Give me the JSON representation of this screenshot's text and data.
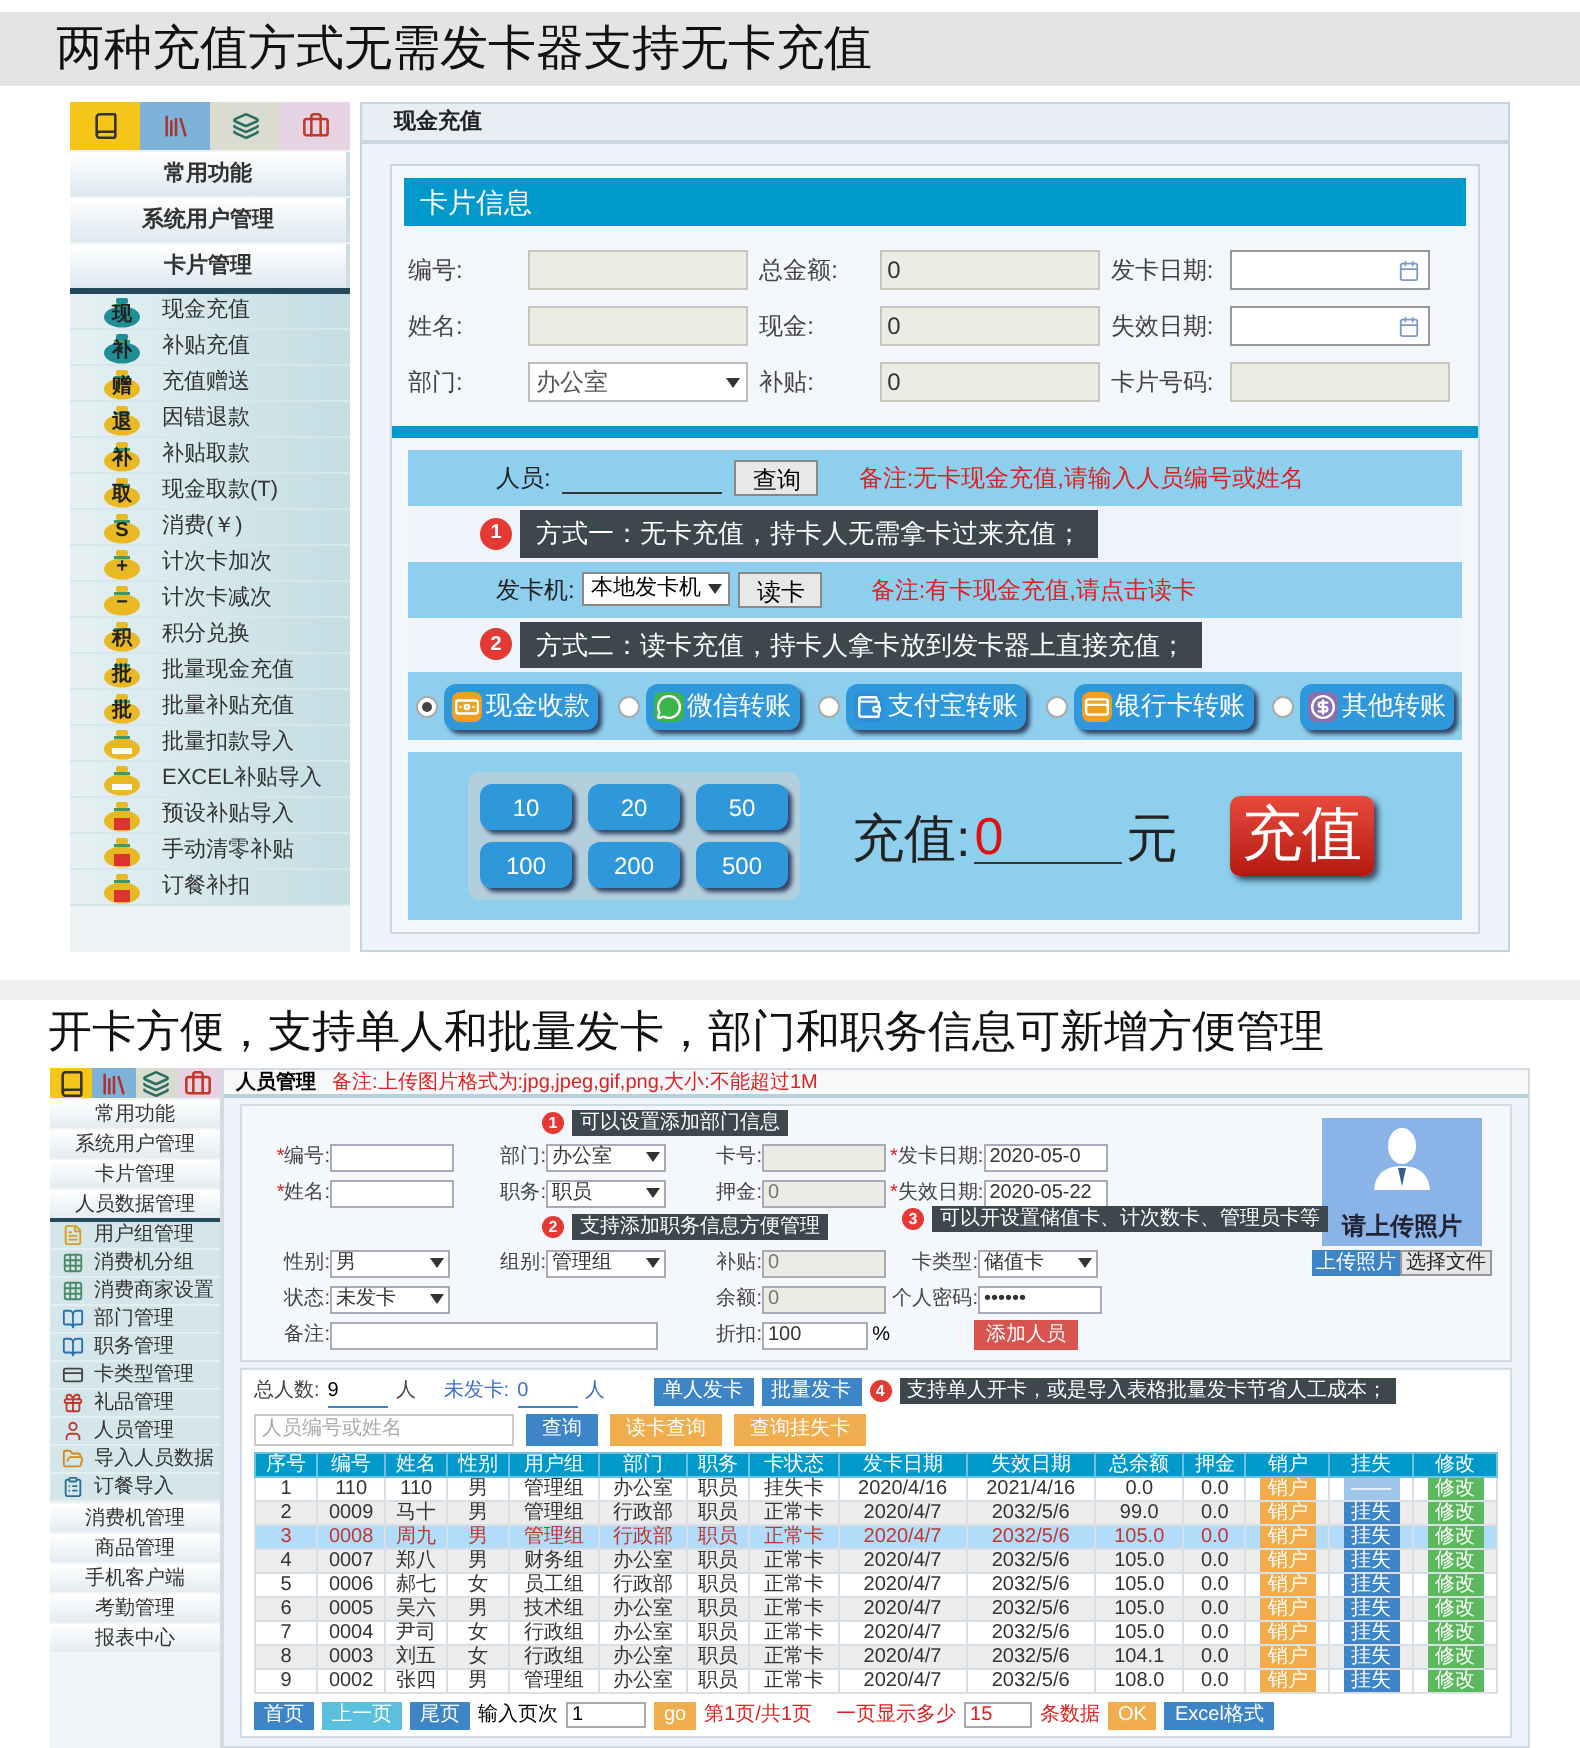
{
  "section_1": {
    "heading": "两种充值方式无需发卡器支持无卡充值",
    "sidebar": {
      "tabs": [
        {
          "kind": "book",
          "color": "#f5c518"
        },
        {
          "kind": "books",
          "color": "#7fb2d9"
        },
        {
          "kind": "layers",
          "color": "#d9dccf"
        },
        {
          "kind": "briefcase",
          "color": "#e6d3e3"
        }
      ],
      "groups": [
        {
          "label": "常用功能"
        },
        {
          "label": "系统用户管理"
        },
        {
          "label": "卡片管理",
          "children": [
            {
              "label": "现金充值",
              "kind": "glyph",
              "badge": "现",
              "color": "#1f8f95"
            },
            {
              "label": "补贴充值",
              "kind": "glyph",
              "badge": "补",
              "color": "#1f8f95"
            },
            {
              "label": "充值赠送",
              "kind": "glyph",
              "badge": "赠",
              "color": "#e8b923"
            },
            {
              "label": "因错退款",
              "kind": "glyph",
              "badge": "退",
              "color": "#e8b923"
            },
            {
              "label": "补贴取款",
              "kind": "glyph",
              "badge": "补",
              "color": "#e8b923"
            },
            {
              "label": "现金取款(T)",
              "kind": "glyph",
              "badge": "取",
              "color": "#e8b923"
            },
            {
              "label": "消费(￥)",
              "kind": "glyph",
              "badge": "S",
              "color": "#e8b923"
            },
            {
              "label": "计次卡加次",
              "kind": "glyph",
              "badge": "+",
              "color": "#e8b923"
            },
            {
              "label": "计次卡减次",
              "kind": "glyph",
              "badge": "−",
              "color": "#e8b923"
            },
            {
              "label": "积分兑换",
              "kind": "glyph",
              "badge": "积",
              "color": "#e8b923"
            },
            {
              "label": "批量现金充值",
              "kind": "glyph",
              "badge": "批",
              "color": "#e8b923"
            },
            {
              "label": "批量补贴充值",
              "kind": "glyph",
              "badge": "批",
              "color": "#e8b923"
            },
            {
              "label": "批量扣款导入",
              "kind": "bar",
              "color": "#e8b923"
            },
            {
              "label": "EXCEL补贴导入",
              "kind": "bar",
              "color": "#e8b923"
            },
            {
              "label": "预设补贴导入",
              "kind": "box",
              "color": "#e8b923"
            },
            {
              "label": "手动清零补贴",
              "kind": "box",
              "color": "#e8b923"
            },
            {
              "label": "订餐补扣",
              "kind": "box",
              "color": "#e8b923"
            }
          ]
        }
      ]
    },
    "page_tab": "现金充值",
    "card_title": "卡片信息",
    "fields": [
      {
        "label": "编号:",
        "kind": "text"
      },
      {
        "label": "总金额:",
        "kind": "text",
        "value": "0"
      },
      {
        "label": "发卡日期:",
        "kind": "date"
      },
      {
        "label": "姓名:",
        "kind": "text"
      },
      {
        "label": "现金:",
        "kind": "text",
        "value": "0"
      },
      {
        "label": "失效日期:",
        "kind": "date"
      },
      {
        "label": "部门:",
        "kind": "select",
        "value": "办公室"
      },
      {
        "label": "补贴:",
        "kind": "text",
        "value": "0"
      },
      {
        "label": "卡片号码:",
        "kind": "text"
      }
    ],
    "person_row": {
      "label": "人员:",
      "button": "查询",
      "note": "备注:无卡现金充值,请输入人员编号或姓名"
    },
    "tip_1": {
      "num": "1",
      "text": "方式一：无卡充值，持卡人无需拿卡过来充值；"
    },
    "reader_row": {
      "label": "发卡机:",
      "select": "本地发卡机",
      "button": "读卡",
      "note": "备注:有卡现金充值,请点击读卡"
    },
    "tip_2": {
      "num": "2",
      "text": "方式二：读卡充值，持卡人拿卡放到发卡器上直接充值；"
    },
    "payments": [
      {
        "label": "现金收款",
        "kind": "cash",
        "selected": true
      },
      {
        "label": "微信转账",
        "kind": "wechat",
        "selected": false
      },
      {
        "label": "支付宝转账",
        "kind": "alipay",
        "selected": false
      },
      {
        "label": "银行卡转账",
        "kind": "bank",
        "selected": false
      },
      {
        "label": "其他转账",
        "kind": "other",
        "selected": false
      }
    ],
    "amounts": [
      "10",
      "20",
      "50",
      "100",
      "200",
      "500"
    ],
    "charge": {
      "label": "充值:",
      "value": "0",
      "unit": "元",
      "button": "充值"
    }
  },
  "section_2": {
    "heading": "开卡方便，支持单人和批量发卡，部门和职务信息可新增方便管理",
    "sidebar": {
      "tabs": [
        {
          "kind": "book",
          "color": "#f5c518"
        },
        {
          "kind": "books",
          "color": "#7fb2d9"
        },
        {
          "kind": "layers",
          "color": "#d9dccf"
        },
        {
          "kind": "briefcase",
          "color": "#e6d3e3"
        }
      ],
      "groups": [
        {
          "label": "常用功能"
        },
        {
          "label": "系统用户管理"
        },
        {
          "label": "卡片管理"
        },
        {
          "label": "人员数据管理",
          "children": [
            {
              "label": "用户组管理",
              "kind": "doc"
            },
            {
              "label": "消费机分组",
              "kind": "grid"
            },
            {
              "label": "消费商家设置",
              "kind": "grid"
            },
            {
              "label": "部门管理",
              "kind": "book"
            },
            {
              "label": "职务管理",
              "kind": "book"
            },
            {
              "label": "卡类型管理",
              "kind": "card"
            },
            {
              "label": "礼品管理",
              "kind": "gift"
            },
            {
              "label": "人员管理",
              "kind": "user"
            },
            {
              "label": "导入人员数据",
              "kind": "folder"
            },
            {
              "label": "订餐导入",
              "kind": "clipboard"
            }
          ]
        },
        {
          "label": "消费机管理"
        },
        {
          "label": "商品管理"
        },
        {
          "label": "手机客户端"
        },
        {
          "label": "考勤管理"
        },
        {
          "label": "报表中心"
        }
      ]
    },
    "page_tab": "人员管理",
    "upload_note": "备注:上传图片格式为:jpg,jpeg,gif,png,大小:不能超过1M",
    "form_rows": [
      [
        {
          "label": "编号:",
          "mark": "*",
          "kind": "text",
          "disabled": false
        },
        {
          "label": "部门:",
          "kind": "select",
          "value": "办公室",
          "disabled": false
        },
        {
          "label": "卡号:",
          "kind": "text",
          "disabled": true
        },
        {
          "label": "发卡日期:",
          "mark": "*",
          "kind": "text",
          "value": "2020-05-0",
          "disabled": false
        }
      ],
      [
        {
          "label": "姓名:",
          "mark": "*",
          "kind": "text",
          "disabled": false
        },
        {
          "label": "职务:",
          "kind": "select",
          "value": "职员",
          "disabled": false
        },
        {
          "label": "押金:",
          "kind": "text",
          "value": "0",
          "disabled": true
        },
        {
          "label": "失效日期:",
          "mark": "*",
          "kind": "text",
          "value": "2020-05-22",
          "disabled": false
        }
      ],
      [
        {
          "label": "性别:",
          "kind": "select",
          "value": "男",
          "disabled": false
        },
        {
          "label": "组别:",
          "kind": "select",
          "value": "管理组",
          "disabled": false
        },
        {
          "label": "补贴:",
          "kind": "text",
          "value": "0",
          "disabled": true
        },
        {
          "label": "卡类型:",
          "kind": "select",
          "value": "储值卡",
          "disabled": false
        }
      ],
      [
        {
          "label": "状态:",
          "kind": "select",
          "value": "未发卡",
          "wide": true,
          "disabled": false
        },
        {
          "label": "余额:",
          "kind": "text",
          "value": "0",
          "disabled": true
        },
        {
          "label": "个人密码:",
          "kind": "text",
          "value": "••••••",
          "disabled": false
        }
      ],
      [
        {
          "label": "备注:",
          "kind": "memo",
          "wide": true,
          "disabled": false
        },
        {
          "label": "折扣:",
          "kind": "text",
          "value": "100",
          "suffix": "%",
          "disabled": false
        },
        {
          "label": "添加人员",
          "kind": "button"
        }
      ]
    ],
    "photo": {
      "caption": "请上传照片",
      "buttons": [
        {
          "label": "上传照片",
          "kind": "primary"
        },
        {
          "label": "选择文件",
          "kind": "plain"
        }
      ]
    },
    "tips": [
      {
        "num": "1",
        "text": "可以设置添加部门信息"
      },
      {
        "num": "2",
        "text": "支持添加职务信息方便管理"
      },
      {
        "num": "3",
        "text": "可以开设置储值卡、计次数卡、管理员卡等"
      },
      {
        "num": "4",
        "text": "支持单人开卡，或是导入表格批量发卡节省人工成本；"
      }
    ],
    "stats": {
      "total_label": "总人数:",
      "total": "9",
      "total_unit": "人",
      "unissued_label": "未发卡:",
      "unissued": "0",
      "unissued_unit": "人"
    },
    "issue_buttons": [
      "单人发卡",
      "批量发卡"
    ],
    "search": {
      "placeholder": "人员编号或姓名"
    },
    "search_buttons": [
      {
        "label": "查询",
        "kind": "primary"
      },
      {
        "label": "读卡查询",
        "kind": "warning"
      },
      {
        "label": "查询挂失卡",
        "kind": "warning"
      }
    ],
    "table": {
      "columns": [
        "序号",
        "编号",
        "姓名",
        "性别",
        "用户组",
        "部门",
        "职务",
        "卡状态",
        "发卡日期",
        "失效日期",
        "总余额",
        "押金",
        "销户",
        "挂失",
        "修改"
      ],
      "rows": [
        {
          "selected": false,
          "cells": [
            "1",
            "110",
            "110",
            "男",
            "管理组",
            "办公室",
            "职员",
            "挂失卡",
            "2020/4/16",
            "2021/4/16",
            "0.0",
            "0.0"
          ],
          "actions": [
            {
              "label": "销户",
              "kind": "cancel",
              "disabled": false
            },
            {
              "label": "——",
              "kind": "loss",
              "disabled": true
            },
            {
              "label": "修改",
              "kind": "edit",
              "disabled": false
            }
          ]
        },
        {
          "selected": false,
          "cells": [
            "2",
            "0009",
            "马十",
            "男",
            "管理组",
            "行政部",
            "职员",
            "正常卡",
            "2020/4/7",
            "2032/5/6",
            "99.0",
            "0.0"
          ],
          "actions": [
            {
              "label": "销户",
              "kind": "cancel",
              "disabled": false
            },
            {
              "label": "挂失",
              "kind": "loss",
              "disabled": false
            },
            {
              "label": "修改",
              "kind": "edit",
              "disabled": false
            }
          ]
        },
        {
          "selected": true,
          "cells": [
            "3",
            "0008",
            "周九",
            "男",
            "管理组",
            "行政部",
            "职员",
            "正常卡",
            "2020/4/7",
            "2032/5/6",
            "105.0",
            "0.0"
          ],
          "actions": [
            {
              "label": "销户",
              "kind": "cancel",
              "disabled": false
            },
            {
              "label": "挂失",
              "kind": "loss",
              "disabled": false
            },
            {
              "label": "修改",
              "kind": "edit",
              "disabled": false
            }
          ]
        },
        {
          "selected": false,
          "cells": [
            "4",
            "0007",
            "郑八",
            "男",
            "财务组",
            "办公室",
            "职员",
            "正常卡",
            "2020/4/7",
            "2032/5/6",
            "105.0",
            "0.0"
          ],
          "actions": [
            {
              "label": "销户",
              "kind": "cancel",
              "disabled": false
            },
            {
              "label": "挂失",
              "kind": "loss",
              "disabled": false
            },
            {
              "label": "修改",
              "kind": "edit",
              "disabled": false
            }
          ]
        },
        {
          "selected": false,
          "cells": [
            "5",
            "0006",
            "郝七",
            "女",
            "员工组",
            "行政部",
            "职员",
            "正常卡",
            "2020/4/7",
            "2032/5/6",
            "105.0",
            "0.0"
          ],
          "actions": [
            {
              "label": "销户",
              "kind": "cancel",
              "disabled": false
            },
            {
              "label": "挂失",
              "kind": "loss",
              "disabled": false
            },
            {
              "label": "修改",
              "kind": "edit",
              "disabled": false
            }
          ]
        },
        {
          "selected": false,
          "cells": [
            "6",
            "0005",
            "吴六",
            "男",
            "技术组",
            "办公室",
            "职员",
            "正常卡",
            "2020/4/7",
            "2032/5/6",
            "105.0",
            "0.0"
          ],
          "actions": [
            {
              "label": "销户",
              "kind": "cancel",
              "disabled": false
            },
            {
              "label": "挂失",
              "kind": "loss",
              "disabled": false
            },
            {
              "label": "修改",
              "kind": "edit",
              "disabled": false
            }
          ]
        },
        {
          "selected": false,
          "cells": [
            "7",
            "0004",
            "尹司",
            "女",
            "行政组",
            "办公室",
            "职员",
            "正常卡",
            "2020/4/7",
            "2032/5/6",
            "105.0",
            "0.0"
          ],
          "actions": [
            {
              "label": "销户",
              "kind": "cancel",
              "disabled": false
            },
            {
              "label": "挂失",
              "kind": "loss",
              "disabled": false
            },
            {
              "label": "修改",
              "kind": "edit",
              "disabled": false
            }
          ]
        },
        {
          "selected": false,
          "cells": [
            "8",
            "0003",
            "刘五",
            "女",
            "行政组",
            "办公室",
            "职员",
            "正常卡",
            "2020/4/7",
            "2032/5/6",
            "104.1",
            "0.0"
          ],
          "actions": [
            {
              "label": "销户",
              "kind": "cancel",
              "disabled": false
            },
            {
              "label": "挂失",
              "kind": "loss",
              "disabled": false
            },
            {
              "label": "修改",
              "kind": "edit",
              "disabled": false
            }
          ]
        },
        {
          "selected": false,
          "cells": [
            "9",
            "0002",
            "张四",
            "男",
            "管理组",
            "办公室",
            "职员",
            "正常卡",
            "2020/4/7",
            "2032/5/6",
            "108.0",
            "0.0"
          ],
          "actions": [
            {
              "label": "销户",
              "kind": "cancel",
              "disabled": false
            },
            {
              "label": "挂失",
              "kind": "loss",
              "disabled": false
            },
            {
              "label": "修改",
              "kind": "edit",
              "disabled": false
            }
          ]
        }
      ]
    },
    "pager": {
      "buttons": [
        "首页",
        "上一页",
        "尾页"
      ],
      "page_label": "输入页次",
      "page_value": "1",
      "go": "go",
      "page_info": "第1页/共1页",
      "size_label": "一页显示多少",
      "size_value": "15",
      "size_unit": "条数据",
      "ok": "OK",
      "excel": "Excel格式"
    }
  }
}
